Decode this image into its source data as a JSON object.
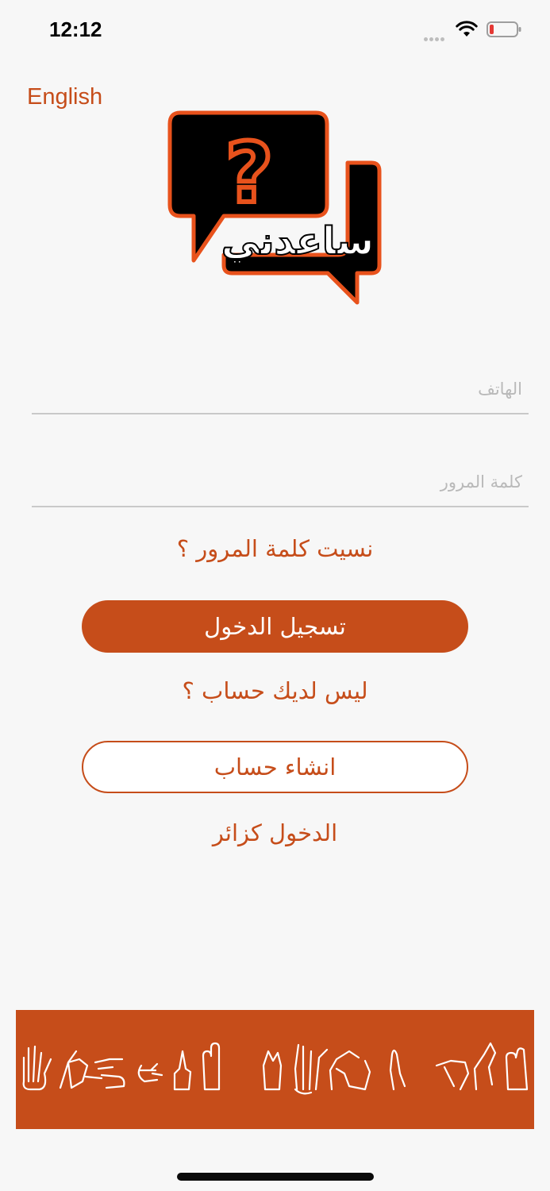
{
  "status_bar": {
    "time": "12:12",
    "icons": [
      "cellular-signal-icon",
      "wifi-icon",
      "battery-low-icon"
    ],
    "battery_color": "#e53935"
  },
  "language_toggle": "English",
  "logo": {
    "symbol": "?",
    "text": "ساعدني",
    "colors": {
      "outline": "#e8521c",
      "fill": "#000000",
      "text": "#ffffff"
    }
  },
  "form": {
    "phone_placeholder": "الهاتف",
    "phone_value": "",
    "password_placeholder": "كلمة المرور",
    "password_value": ""
  },
  "forgot_password": "نسيت كلمة المرور ؟",
  "login_button": "تسجيل الدخول",
  "no_account_text": "ليس لديك حساب ؟",
  "create_account_button": "انشاء حساب",
  "guest_login": "الدخول كزائر",
  "banner": {
    "content": "sign-language-hands-illustration",
    "background": "#c64d1a"
  },
  "colors": {
    "accent": "#c64d1a",
    "background": "#f7f7f7"
  }
}
